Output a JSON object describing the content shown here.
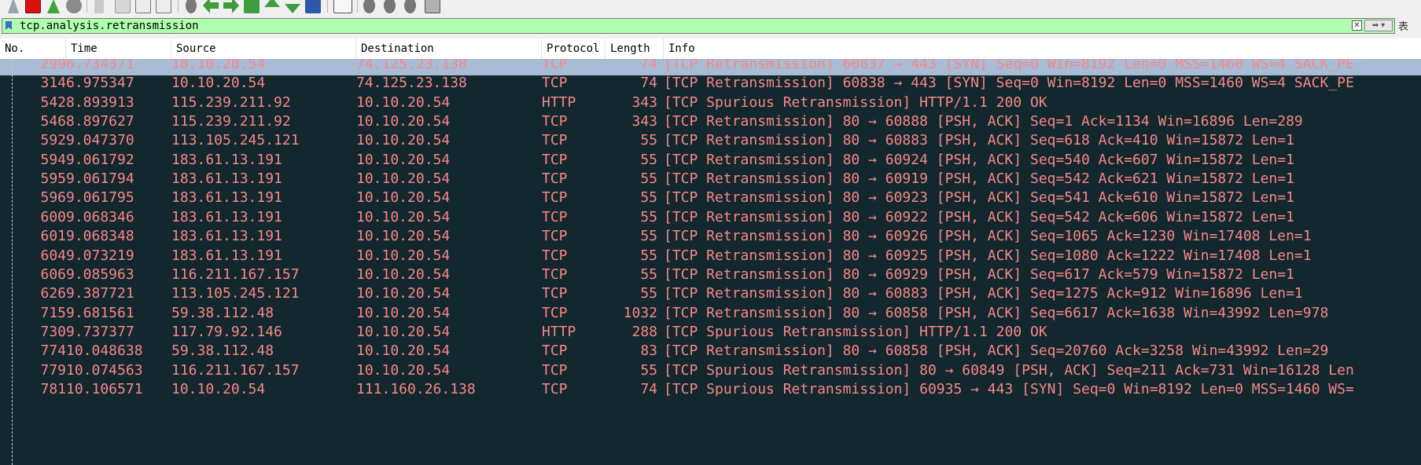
{
  "filter": {
    "value": "tcp.analysis.retransmission",
    "expression_label": "表"
  },
  "columns": [
    "No.",
    "Time",
    "Source",
    "Destination",
    "Protocol",
    "Length",
    "Info"
  ],
  "packets": [
    {
      "no": "299",
      "time": "6.734371",
      "src": "10.10.20.54",
      "dst": "74.125.23.138",
      "proto": "TCP",
      "len": "74",
      "info": "[TCP Retransmission] 60837 → 443 [SYN] Seq=0 Win=8192 Len=0 MSS=1460 WS=4 SACK_PE"
    },
    {
      "no": "314",
      "time": "6.975347",
      "src": "10.10.20.54",
      "dst": "74.125.23.138",
      "proto": "TCP",
      "len": "74",
      "info": "[TCP Retransmission] 60838 → 443 [SYN] Seq=0 Win=8192 Len=0 MSS=1460 WS=4 SACK_PE"
    },
    {
      "no": "542",
      "time": "8.893913",
      "src": "115.239.211.92",
      "dst": "10.10.20.54",
      "proto": "HTTP",
      "len": "343",
      "info": "[TCP Spurious Retransmission] HTTP/1.1 200 OK"
    },
    {
      "no": "546",
      "time": "8.897627",
      "src": "115.239.211.92",
      "dst": "10.10.20.54",
      "proto": "TCP",
      "len": "343",
      "info": "[TCP Retransmission] 80 → 60888 [PSH, ACK] Seq=1 Ack=1134 Win=16896 Len=289"
    },
    {
      "no": "592",
      "time": "9.047370",
      "src": "113.105.245.121",
      "dst": "10.10.20.54",
      "proto": "TCP",
      "len": "55",
      "info": "[TCP Retransmission] 80 → 60883 [PSH, ACK] Seq=618 Ack=410 Win=15872 Len=1"
    },
    {
      "no": "594",
      "time": "9.061792",
      "src": "183.61.13.191",
      "dst": "10.10.20.54",
      "proto": "TCP",
      "len": "55",
      "info": "[TCP Retransmission] 80 → 60924 [PSH, ACK] Seq=540 Ack=607 Win=15872 Len=1"
    },
    {
      "no": "595",
      "time": "9.061794",
      "src": "183.61.13.191",
      "dst": "10.10.20.54",
      "proto": "TCP",
      "len": "55",
      "info": "[TCP Retransmission] 80 → 60919 [PSH, ACK] Seq=542 Ack=621 Win=15872 Len=1"
    },
    {
      "no": "596",
      "time": "9.061795",
      "src": "183.61.13.191",
      "dst": "10.10.20.54",
      "proto": "TCP",
      "len": "55",
      "info": "[TCP Retransmission] 80 → 60923 [PSH, ACK] Seq=541 Ack=610 Win=15872 Len=1"
    },
    {
      "no": "600",
      "time": "9.068346",
      "src": "183.61.13.191",
      "dst": "10.10.20.54",
      "proto": "TCP",
      "len": "55",
      "info": "[TCP Retransmission] 80 → 60922 [PSH, ACK] Seq=542 Ack=606 Win=15872 Len=1"
    },
    {
      "no": "601",
      "time": "9.068348",
      "src": "183.61.13.191",
      "dst": "10.10.20.54",
      "proto": "TCP",
      "len": "55",
      "info": "[TCP Retransmission] 80 → 60926 [PSH, ACK] Seq=1065 Ack=1230 Win=17408 Len=1"
    },
    {
      "no": "604",
      "time": "9.073219",
      "src": "183.61.13.191",
      "dst": "10.10.20.54",
      "proto": "TCP",
      "len": "55",
      "info": "[TCP Retransmission] 80 → 60925 [PSH, ACK] Seq=1080 Ack=1222 Win=17408 Len=1"
    },
    {
      "no": "606",
      "time": "9.085963",
      "src": "116.211.167.157",
      "dst": "10.10.20.54",
      "proto": "TCP",
      "len": "55",
      "info": "[TCP Retransmission] 80 → 60929 [PSH, ACK] Seq=617 Ack=579 Win=15872 Len=1"
    },
    {
      "no": "626",
      "time": "9.387721",
      "src": "113.105.245.121",
      "dst": "10.10.20.54",
      "proto": "TCP",
      "len": "55",
      "info": "[TCP Retransmission] 80 → 60883 [PSH, ACK] Seq=1275 Ack=912 Win=16896 Len=1"
    },
    {
      "no": "715",
      "time": "9.681561",
      "src": "59.38.112.48",
      "dst": "10.10.20.54",
      "proto": "TCP",
      "len": "1032",
      "info": "[TCP Retransmission] 80 → 60858 [PSH, ACK] Seq=6617 Ack=1638 Win=43992 Len=978"
    },
    {
      "no": "730",
      "time": "9.737377",
      "src": "117.79.92.146",
      "dst": "10.10.20.54",
      "proto": "HTTP",
      "len": "288",
      "info": "[TCP Spurious Retransmission] HTTP/1.1 200 OK"
    },
    {
      "no": "774",
      "time": "10.048638",
      "src": "59.38.112.48",
      "dst": "10.10.20.54",
      "proto": "TCP",
      "len": "83",
      "info": "[TCP Retransmission] 80 → 60858 [PSH, ACK] Seq=20760 Ack=3258 Win=43992 Len=29"
    },
    {
      "no": "779",
      "time": "10.074563",
      "src": "116.211.167.157",
      "dst": "10.10.20.54",
      "proto": "TCP",
      "len": "55",
      "info": "[TCP Spurious Retransmission] 80 → 60849 [PSH, ACK] Seq=211 Ack=731 Win=16128 Len"
    },
    {
      "no": "781",
      "time": "10.106571",
      "src": "10.10.20.54",
      "dst": "111.160.26.138",
      "proto": "TCP",
      "len": "74",
      "info": "[TCP Spurious Retransmission] 60935 → 443 [SYN] Seq=0 Win=8192 Len=0 MSS=1460 WS="
    }
  ],
  "colors": {
    "list_background": "#12272e",
    "packet_text": "#f78787",
    "selected_row": "#a8bcd6",
    "filter_valid": "#afffaf"
  },
  "icons": {
    "toolbar": [
      "shark-fin-icon",
      "stop-icon",
      "restart-icon",
      "options-icon",
      "open-icon",
      "save-icon",
      "close-icon",
      "reload-icon",
      "find-icon",
      "back-icon",
      "forward-icon",
      "goto-icon",
      "first-icon",
      "last-icon",
      "autoscroll-icon",
      "colorize-icon",
      "zoom-in-icon",
      "zoom-out-icon",
      "zoom-reset-icon",
      "resize-columns-icon"
    ],
    "filter": [
      "bookmark-icon",
      "clear-filter-icon",
      "apply-filter-icon"
    ]
  }
}
